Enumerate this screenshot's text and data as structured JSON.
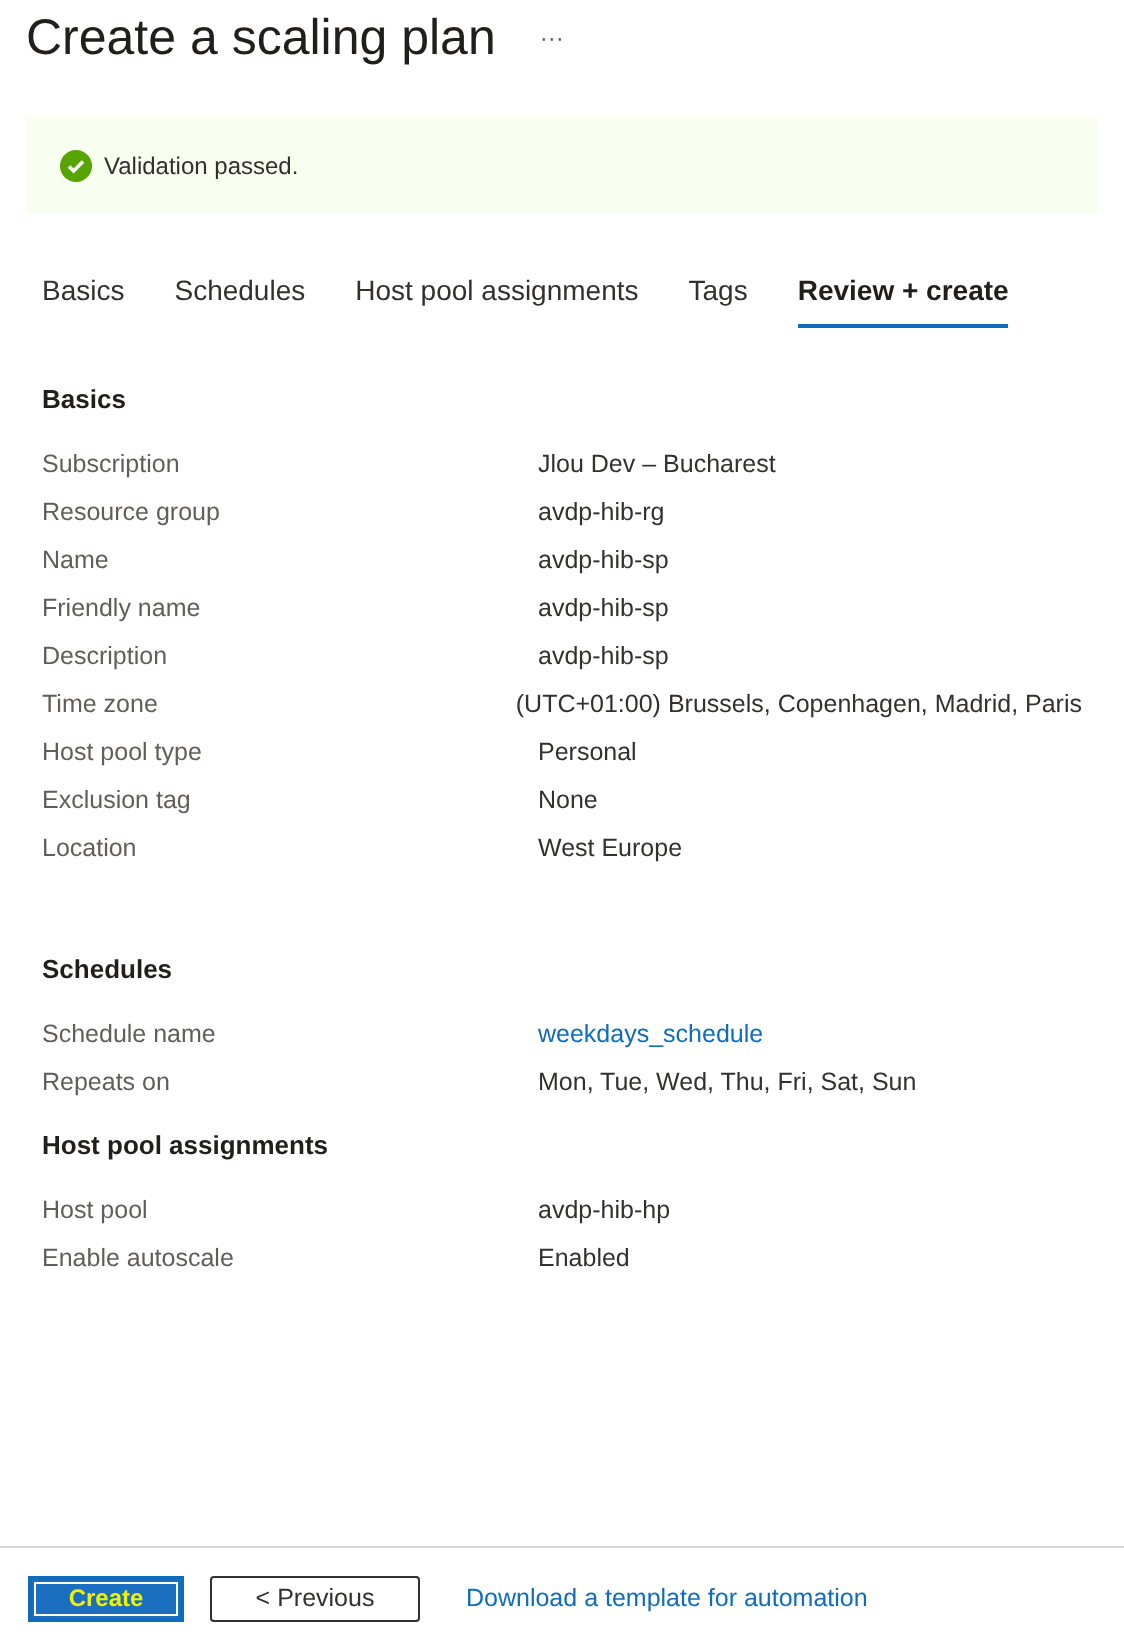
{
  "title": "Create a scaling plan",
  "more": "···",
  "banner": {
    "text": "Validation passed."
  },
  "tabs": [
    {
      "label": "Basics",
      "selected": false
    },
    {
      "label": "Schedules",
      "selected": false
    },
    {
      "label": "Host pool assignments",
      "selected": false
    },
    {
      "label": "Tags",
      "selected": false
    },
    {
      "label": "Review + create",
      "selected": true
    }
  ],
  "sections": [
    {
      "heading": "Basics",
      "rows": [
        {
          "label": "Subscription",
          "value": "Jlou Dev – Bucharest"
        },
        {
          "label": "Resource group",
          "value": "avdp-hib-rg"
        },
        {
          "label": "Name",
          "value": "avdp-hib-sp"
        },
        {
          "label": "Friendly name",
          "value": "avdp-hib-sp"
        },
        {
          "label": "Description",
          "value": "avdp-hib-sp"
        },
        {
          "label": "Time zone",
          "value": "(UTC+01:00) Brussels, Copenhagen, Madrid, Paris"
        },
        {
          "label": "Host pool type",
          "value": "Personal"
        },
        {
          "label": "Exclusion tag",
          "value": "None"
        },
        {
          "label": "Location",
          "value": "West Europe"
        }
      ]
    },
    {
      "heading": "Schedules",
      "rows": [
        {
          "label": "Schedule name",
          "value": "weekdays_schedule",
          "kind": "link"
        },
        {
          "label": "Repeats on",
          "value": "Mon, Tue, Wed, Thu, Fri, Sat, Sun"
        }
      ]
    },
    {
      "heading": "Host pool assignments",
      "rows": [
        {
          "label": "Host pool",
          "value": "avdp-hib-hp"
        },
        {
          "label": "Enable autoscale",
          "value": "Enabled"
        }
      ]
    }
  ],
  "footer": {
    "create": "Create",
    "previous": "< Previous",
    "download": "Download a template for automation"
  }
}
